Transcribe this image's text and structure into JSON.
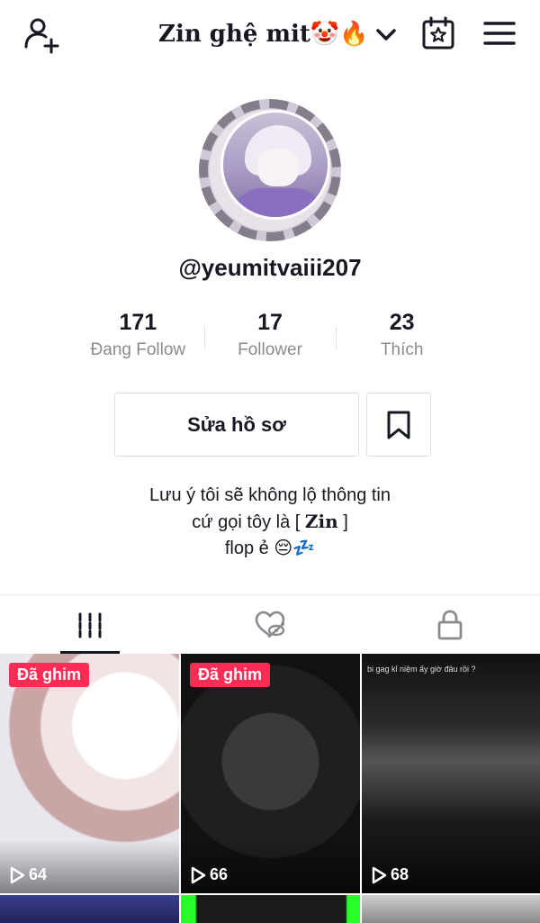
{
  "header": {
    "title": "Zin ghệ mit🤡🔥",
    "icons": [
      "add-user-icon",
      "chevron-down-icon",
      "calendar-star-icon",
      "menu-icon"
    ]
  },
  "profile": {
    "username": "@yeumitvaiii207",
    "stats": [
      {
        "value": "171",
        "label": "Đang Follow"
      },
      {
        "value": "17",
        "label": "Follower"
      },
      {
        "value": "23",
        "label": "Thích"
      }
    ],
    "edit_label": "Sửa hồ sơ",
    "bio_line1": "Lưu ý tôi sẽ không lộ thông tin",
    "bio_line2_pre": "cứ gọi tôy là [ ",
    "bio_line2_name": "Zin",
    "bio_line2_post": " ]",
    "bio_line3": "flop ẻ 😔💤"
  },
  "tabs": [
    {
      "name": "videos-tab",
      "icon": "grid-icon",
      "active": true
    },
    {
      "name": "liked-tab",
      "icon": "heart-hidden-icon",
      "active": false
    },
    {
      "name": "private-tab",
      "icon": "lock-icon",
      "active": false
    }
  ],
  "videos": [
    {
      "pinned": true,
      "pin_label": "Đã ghim",
      "views": "64"
    },
    {
      "pinned": true,
      "pin_label": "Đã ghim",
      "views": "66"
    },
    {
      "pinned": false,
      "caption": "bi gag kỉ niệm ấy giờ đâu rồi ?",
      "views": "68"
    }
  ],
  "colors": {
    "accent": "#fe2c55",
    "text": "#161823",
    "muted": "#8a8b91"
  }
}
